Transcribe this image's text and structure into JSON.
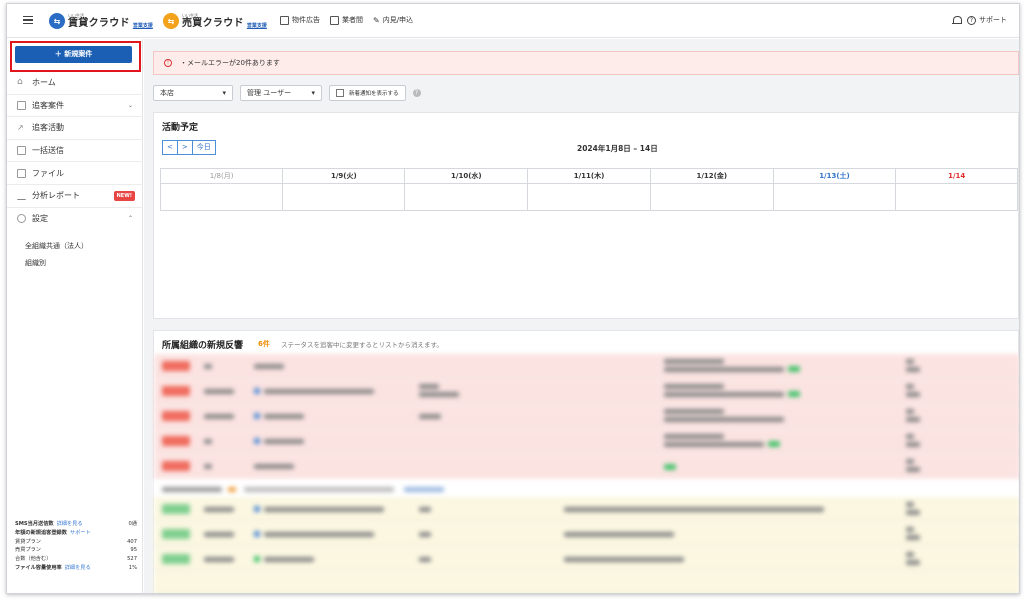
{
  "header": {
    "brand1": {
      "small": "いい生活",
      "name": "賃貸クラウド",
      "sub": "営業支援",
      "color": "#2b6cc4"
    },
    "brand2": {
      "small": "いい生活",
      "name": "売買クラウド",
      "sub": "営業支援",
      "color": "#f2a21b"
    },
    "nav": [
      "物件広告",
      "業者間",
      "内見/申込"
    ],
    "support": "サポート"
  },
  "sidebar": {
    "new_button": "＋ 新規案件",
    "items": [
      {
        "label": "ホーム",
        "icon": "home-icon"
      },
      {
        "label": "追客案件",
        "icon": "list-icon",
        "caret": "⌄"
      },
      {
        "label": "追客活動",
        "icon": "activity-icon"
      },
      {
        "label": "一括送信",
        "icon": "mail-icon"
      },
      {
        "label": "ファイル",
        "icon": "file-icon"
      },
      {
        "label": "分析レポート",
        "icon": "chart-icon",
        "badge": "NEW!"
      },
      {
        "label": "設定",
        "icon": "gear-icon",
        "caret": "⌃"
      }
    ],
    "sub_items": [
      "全組織共通（法人）",
      "組織別"
    ],
    "stats": {
      "sms_label": "SMS当月送信数",
      "sms_link": "詳細を見る",
      "sms_value": "0通",
      "annual_label": "年額の新規追客登録数",
      "annual_link": "サポート",
      "rows": [
        {
          "label": "賃貸プラン",
          "value": "407"
        },
        {
          "label": "売買プラン",
          "value": "95"
        },
        {
          "label": "合数（他含む）",
          "value": "527"
        }
      ],
      "file_label": "ファイル容量使用率",
      "file_link": "詳細を見る",
      "file_value": "1%"
    }
  },
  "alert": {
    "text": "・メールエラーが20件あります"
  },
  "filters": {
    "store": "本店",
    "user": "管理 ユーザー",
    "checkbox": "新着通知を表示する"
  },
  "schedule": {
    "title": "活動予定",
    "prev": "<",
    "next": ">",
    "today": "今日",
    "range": "2024年1月8日 – 14日",
    "days": [
      "1/8(月)",
      "1/9(火)",
      "1/10(水)",
      "1/11(木)",
      "1/12(金)",
      "1/13(土)",
      "1/14"
    ]
  },
  "responses": {
    "title": "所属組織の新規反響",
    "count": "6件",
    "note": "ステータスを追客中に変更するとリストから消えます。"
  }
}
